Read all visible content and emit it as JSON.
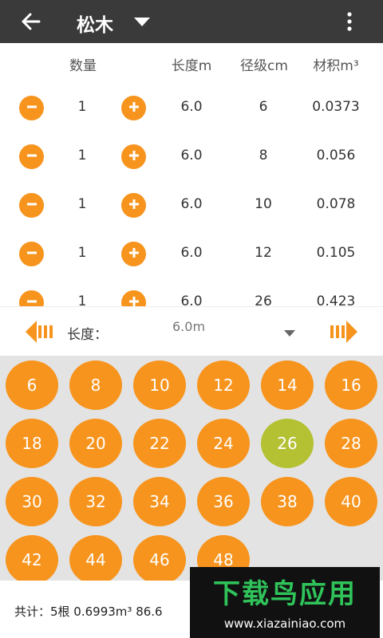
{
  "appbar": {
    "title": "松木"
  },
  "columns": {
    "quantity": "数量",
    "length": "长度m",
    "diameter": "径级cm",
    "volume": "材积m³"
  },
  "rows": [
    {
      "qty": "1",
      "length": "6.0",
      "diameter": "6",
      "volume": "0.0373"
    },
    {
      "qty": "1",
      "length": "6.0",
      "diameter": "8",
      "volume": "0.056"
    },
    {
      "qty": "1",
      "length": "6.0",
      "diameter": "10",
      "volume": "0.078"
    },
    {
      "qty": "1",
      "length": "6.0",
      "diameter": "12",
      "volume": "0.105"
    },
    {
      "qty": "1",
      "length": "6.0",
      "diameter": "26",
      "volume": "0.423"
    }
  ],
  "length_bar": {
    "label": "长度：",
    "value": "6.0m"
  },
  "diameters": [
    "6",
    "8",
    "10",
    "12",
    "14",
    "16",
    "18",
    "20",
    "22",
    "24",
    "26",
    "28",
    "30",
    "32",
    "34",
    "36",
    "38",
    "40",
    "42",
    "44",
    "46",
    "48"
  ],
  "selected_diameter": "26",
  "footer": {
    "total": "共计：5根 0.6993m³ 86.6"
  },
  "watermark": {
    "text": "下载鸟应用",
    "url": "www.xiazainiao.com"
  },
  "colors": {
    "accent": "#f7941d",
    "selected": "#b3c132",
    "appbar": "#3a3a3a",
    "grid_bg": "#e3e3e3"
  }
}
